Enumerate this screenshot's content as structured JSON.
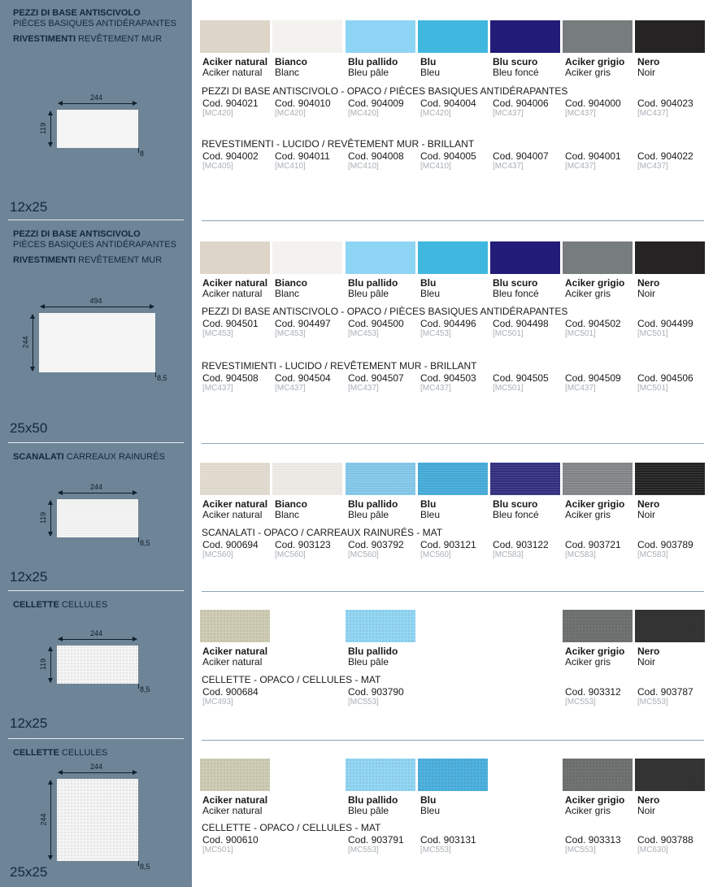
{
  "sections": [
    {
      "side": {
        "it1": "PEZZI DI BASE ANTISCIVOLO",
        "fr1": "PIÈCES BASIQUES ANTIDÉRAPANTES",
        "it2": "RIVESTIMENTI",
        "fr2": "REVÊTEMENT MUR"
      },
      "dims": {
        "w": "244",
        "h": "119",
        "t": "8"
      },
      "size": "12x25",
      "colors": [
        {
          "it": "Aciker natural",
          "fr": "Aciker natural",
          "hex": "#ddd5c8"
        },
        {
          "it": "Bianco",
          "fr": "Blanc",
          "hex": "#f3f2ee"
        },
        {
          "it": "Blu pallido",
          "fr": "Bleu pâle",
          "hex": "#8ed4f4"
        },
        {
          "it": "Blu",
          "fr": "Bleu",
          "hex": "#40b7df"
        },
        {
          "it": "Blu scuro",
          "fr": "Bleu foncé",
          "hex": "#231b78"
        },
        {
          "it": "Aciker grigio",
          "fr": "Aciker gris",
          "hex": "#777c7d"
        },
        {
          "it": "Nero",
          "fr": "Noir",
          "hex": "#252323"
        }
      ],
      "groups": [
        {
          "title_b": "PEZZI DI BASE ANTISCIVOLO - OPACO",
          "title_r": " / PIÈCES BASIQUES ANTIDÉRAPANTES",
          "codes": [
            "Cod. 904021",
            "Cod. 904010",
            "Cod. 904009",
            "Cod. 904004",
            "Cod. 904006",
            "Cod. 904000",
            "Cod. 904023"
          ],
          "mcs": [
            "[MC420]",
            "[MC420]",
            "[MC420]",
            "[MC420]",
            "[MC437]",
            "[MC437]",
            "[MC437]"
          ]
        },
        {
          "title_b": "REVESTIMENTI - LUCIDO",
          "title_r": " / REVÊTEMENT MUR - BRILLANT",
          "codes": [
            "Cod. 904002",
            "Cod. 904011",
            "Cod. 904008",
            "Cod. 904005",
            "Cod. 904007",
            "Cod. 904001",
            "Cod. 904022"
          ],
          "mcs": [
            "[MC405]",
            "[MC410]",
            "[MC410]",
            "[MC410]",
            "[MC437]",
            "[MC437]",
            "[MC437]"
          ]
        }
      ]
    },
    {
      "side": {
        "it1": "PEZZI DI BASE ANTISCIVOLO",
        "fr1": "PIÈCES BASIQUES ANTIDÉRAPANTES",
        "it2": "RIVESTIMENTI",
        "fr2": "REVÊTEMENT MUR"
      },
      "dims": {
        "w": "494",
        "h": "244",
        "t": "8,5"
      },
      "size": "25x50",
      "colors": [
        {
          "it": "Aciker natural",
          "fr": "Aciker natural",
          "hex": "#ddd5c8"
        },
        {
          "it": "Bianco",
          "fr": "Blanc",
          "hex": "#f3f2ee"
        },
        {
          "it": "Blu pallido",
          "fr": "Bleu pâle",
          "hex": "#8ed4f4"
        },
        {
          "it": "Blu",
          "fr": "Bleu",
          "hex": "#40b7df"
        },
        {
          "it": "Blu scuro",
          "fr": "Bleu foncé",
          "hex": "#231b78"
        },
        {
          "it": "Aciker grigio",
          "fr": "Aciker gris",
          "hex": "#777c7d"
        },
        {
          "it": "Nero",
          "fr": "Noir",
          "hex": "#252323"
        }
      ],
      "groups": [
        {
          "title_b": "PEZZI DI BASE ANTISCIVOLO - OPACO",
          "title_r": " / PIÈCES BASIQUES ANTIDÉRAPANTES",
          "codes": [
            "Cod. 904501",
            "Cod. 904497",
            "Cod. 904500",
            "Cod. 904496",
            "Cod. 904498",
            "Cod. 904502",
            "Cod. 904499"
          ],
          "mcs": [
            "[MC453]",
            "[MC453]",
            "[MC453]",
            "[MC453]",
            "[MC501]",
            "[MC501]",
            "[MC501]"
          ]
        },
        {
          "title_b": "REVESTIMIENTI - LUCIDO",
          "title_r": " / REVÊTEMENT MUR - BRILLANT",
          "codes": [
            "Cod. 904508",
            "Cod. 904504",
            "Cod. 904507",
            "Cod. 904503",
            "Cod. 904505",
            "Cod. 904509",
            "Cod. 904506"
          ],
          "mcs": [
            "[MC437]",
            "[MC437]",
            "[MC437]",
            "[MC437]",
            "[MC501]",
            "[MC437]",
            "[MC501]"
          ]
        }
      ]
    },
    {
      "side": {
        "it1": "SCANALATI",
        "fr1": "CARREAUX RAINURÉS"
      },
      "dims": {
        "w": "244",
        "h": "119",
        "t": "8,5"
      },
      "size": "12x25",
      "colors": [
        {
          "it": "Aciker natural",
          "fr": "Aciker natural",
          "hex": "#e2dbcf"
        },
        {
          "it": "Bianco",
          "fr": "Blanc",
          "hex": "#eeece6"
        },
        {
          "it": "Blu pallido",
          "fr": "Bleu pâle",
          "hex": "#7fc7ea"
        },
        {
          "it": "Blu",
          "fr": "Bleu",
          "hex": "#3fa9d8"
        },
        {
          "it": "Blu scuro",
          "fr": "Bleu foncé",
          "hex": "#2c2a7c"
        },
        {
          "it": "Aciker grigio",
          "fr": "Aciker gris",
          "hex": "#808283"
        },
        {
          "it": "Nero",
          "fr": "Noir",
          "hex": "#1d1b1c"
        }
      ],
      "groups": [
        {
          "title_b": "SCANALATI - OPACO",
          "title_r": " / CARREAUX RAINURÉS - MAT",
          "codes": [
            "Cod. 900694",
            "Cod. 903123",
            "Cod. 903792",
            "Cod. 903121",
            "Cod. 903122",
            "Cod. 903721",
            "Cod. 903789"
          ],
          "mcs": [
            "[MC560]",
            "[MC560]",
            "[MC560]",
            "[MC560]",
            "[MC583]",
            "[MC583]",
            "[MC583]"
          ]
        }
      ]
    },
    {
      "side": {
        "it1": "CELLETTE",
        "fr1": "CELLULES"
      },
      "dims": {
        "w": "244",
        "h": "119",
        "t": "8,5"
      },
      "size": "12x25",
      "colors": [
        {
          "it": "Aciker natural",
          "fr": "Aciker natural",
          "hex": "#cfcdb5"
        },
        null,
        {
          "it": "Blu pallido",
          "fr": "Bleu pâle",
          "hex": "#93d7f5"
        },
        null,
        null,
        {
          "it": "Aciker grigio",
          "fr": "Aciker gris",
          "hex": "#6f7372"
        },
        {
          "it": "Nero",
          "fr": "Noir",
          "hex": "#353434"
        }
      ],
      "groups": [
        {
          "title_b": "CELLETTE - OPACO",
          "title_r": " / CELLULES - MAT",
          "codes": [
            "Cod. 900684",
            "",
            "Cod. 903790",
            "",
            "",
            "Cod. 903312",
            "Cod. 903787"
          ],
          "mcs": [
            "[MC493]",
            "",
            "[MC553]",
            "",
            "",
            "[MC553]",
            "[MC553]"
          ]
        }
      ]
    },
    {
      "side": {
        "it1": "CELLETTE",
        "fr1": "CELLULES"
      },
      "dims": {
        "w": "244",
        "h": "244",
        "t": "8,5"
      },
      "size": "25x25",
      "colors": [
        {
          "it": "Aciker natural",
          "fr": "Aciker natural",
          "hex": "#cfcdb5"
        },
        null,
        {
          "it": "Blu pallido",
          "fr": "Bleu pâle",
          "hex": "#93d7f5"
        },
        {
          "it": "Blu",
          "fr": "Bleu",
          "hex": "#4fb1de"
        },
        null,
        {
          "it": "Aciker grigio",
          "fr": "Aciker gris",
          "hex": "#6f7372"
        },
        {
          "it": "Nero",
          "fr": "Noir",
          "hex": "#353434"
        }
      ],
      "groups": [
        {
          "title_b": "CELLETTE - OPACO",
          "title_r": " / CELLULES - MAT",
          "codes": [
            "Cod. 900610",
            "",
            "Cod. 903791",
            "Cod. 903131",
            "",
            "Cod. 903313",
            "Cod. 903788"
          ],
          "mcs": [
            "[MC501]",
            "",
            "[MC553]",
            "[MC553]",
            "",
            "[MC553]",
            "[MC630]"
          ]
        }
      ]
    }
  ]
}
